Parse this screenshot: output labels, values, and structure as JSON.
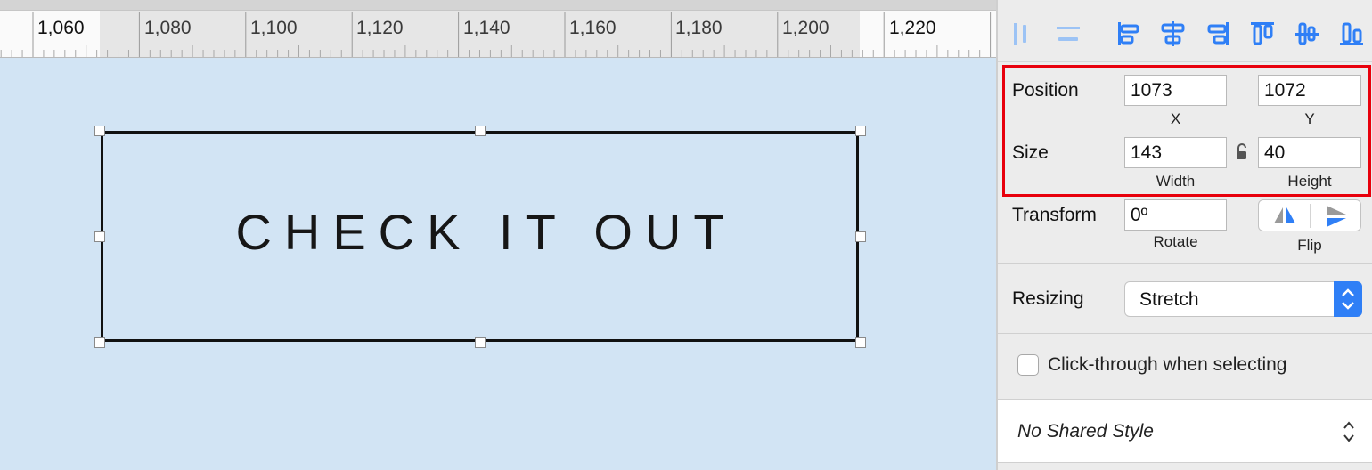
{
  "ruler": {
    "labels": [
      "1,060",
      "1,080",
      "1,100",
      "1,120",
      "1,140",
      "1,160",
      "1,180",
      "1,200",
      "1,220"
    ]
  },
  "canvas": {
    "layer_text": "CHECK IT OUT"
  },
  "inspector": {
    "align_tools": [
      "distribute-horizontal-icon",
      "distribute-vertical-icon",
      "align-left-icon",
      "align-center-horizontal-icon",
      "align-right-icon",
      "align-top-icon",
      "align-middle-icon",
      "align-bottom-icon"
    ],
    "position": {
      "label": "Position",
      "x": "1073",
      "y": "1072",
      "x_label": "X",
      "y_label": "Y"
    },
    "size": {
      "label": "Size",
      "width": "143",
      "height": "40",
      "width_label": "Width",
      "height_label": "Height"
    },
    "transform": {
      "label": "Transform",
      "rotate": "0º",
      "rotate_label": "Rotate",
      "flip_label": "Flip"
    },
    "resizing": {
      "label": "Resizing",
      "value": "Stretch"
    },
    "click_through": {
      "label": "Click-through when selecting",
      "checked": false
    },
    "shared_style": {
      "value": "No Shared Style"
    }
  },
  "colors": {
    "canvas_bg": "#d2e4f4",
    "accent": "#2f7ff6",
    "highlight_box": "#e8000c"
  }
}
